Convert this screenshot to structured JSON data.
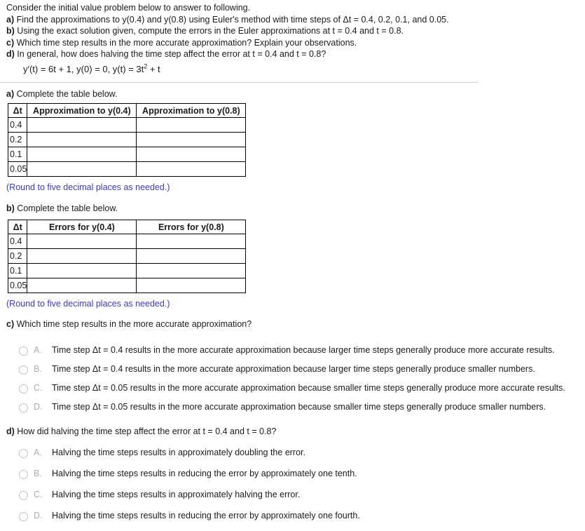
{
  "intro": {
    "lines": [
      {
        "label": "",
        "text": "Consider the initial value problem below to answer to following."
      },
      {
        "label": "a)",
        "text": "Find the approximations to y(0.4) and y(0.8) using Euler's method with time steps of Δt = 0.4, 0.2, 0.1, and 0.05."
      },
      {
        "label": "b)",
        "text": "Using the exact solution given, compute the errors in the Euler approximations at t = 0.4 and t = 0.8."
      },
      {
        "label": "c)",
        "text": "Which time step results in the more accurate approximation? Explain your observations."
      },
      {
        "label": "d)",
        "text": "In general, how does halving the time step affect the error at t = 0.4 and t = 0.8?"
      }
    ],
    "equation_pre": "y′(t) = 6t + 1, y(0) = 0, y(t) = 3t",
    "equation_sup": "2",
    "equation_post": " + t"
  },
  "section_a": {
    "label": "a)",
    "heading": "Complete the table below.",
    "table": {
      "headers": [
        "Δt",
        "Approximation to y(0.4)",
        "Approximation to y(0.8)"
      ],
      "rows": [
        {
          "dt": "0.4",
          "col1": "",
          "col2": ""
        },
        {
          "dt": "0.2",
          "col1": "",
          "col2": ""
        },
        {
          "dt": "0.1",
          "col1": "",
          "col2": ""
        },
        {
          "dt": "0.05",
          "col1": "",
          "col2": ""
        }
      ]
    },
    "note": "(Round to five decimal places as needed.)"
  },
  "section_b": {
    "label": "b)",
    "heading": "Complete the table below.",
    "table": {
      "headers": [
        "Δt",
        "Errors for y(0.4)",
        "Errors for y(0.8)"
      ],
      "rows": [
        {
          "dt": "0.4",
          "col1": "",
          "col2": ""
        },
        {
          "dt": "0.2",
          "col1": "",
          "col2": ""
        },
        {
          "dt": "0.1",
          "col1": "",
          "col2": ""
        },
        {
          "dt": "0.05",
          "col1": "",
          "col2": ""
        }
      ]
    },
    "note": "(Round to five decimal places as needed.)"
  },
  "section_c": {
    "label": "c)",
    "heading": "Which time step results in the more accurate approximation?",
    "choices": [
      {
        "letter": "A.",
        "text": "Time step Δt = 0.4 results in the more accurate approximation because larger time steps generally produce more accurate results.",
        "selected": false
      },
      {
        "letter": "B.",
        "text": "Time step Δt = 0.4 results in the more accurate approximation because larger time steps generally produce smaller numbers.",
        "selected": false
      },
      {
        "letter": "C.",
        "text": "Time step Δt = 0.05 results in the more accurate approximation because smaller time steps generally produce more accurate results.",
        "selected": false
      },
      {
        "letter": "D.",
        "text": "Time step Δt = 0.05 results in the more accurate approximation because smaller time steps generally produce smaller numbers.",
        "selected": false
      }
    ]
  },
  "section_d": {
    "label": "d)",
    "heading": "How did halving the time step affect the error at t = 0.4 and t = 0.8?",
    "choices": [
      {
        "letter": "A.",
        "text": "Halving the time steps results in approximately doubling the error.",
        "selected": false
      },
      {
        "letter": "B.",
        "text": "Halving the time steps results in reducing the error by approximately one tenth.",
        "selected": false
      },
      {
        "letter": "C.",
        "text": "Halving the time steps results in approximately halving the error.",
        "selected": false
      },
      {
        "letter": "D.",
        "text": "Halving the time steps results in reducing the error by approximately one fourth.",
        "selected": false
      }
    ]
  },
  "colors": {
    "text": "#1a1a1a",
    "note": "#3b3bc8",
    "rule": "#c8cdd4",
    "radio_border": "#bfc4c9",
    "choice_letter": "#a8adb3",
    "table_border": "#000000"
  }
}
